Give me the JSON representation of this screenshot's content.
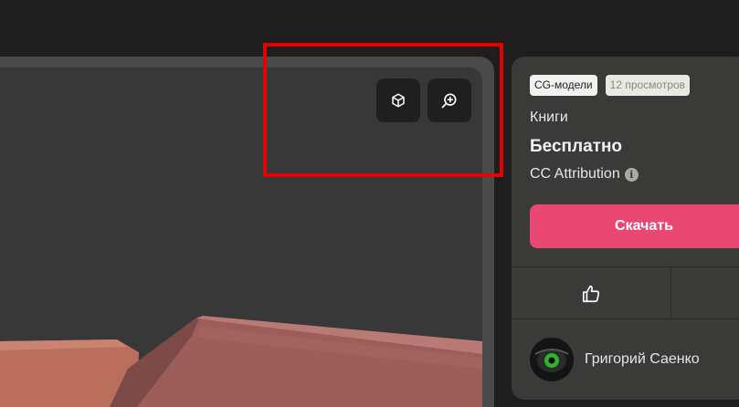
{
  "viewer": {
    "btn_3d_icon": "cube-icon",
    "btn_zoom_icon": "zoom-in-icon"
  },
  "sidebar": {
    "tags": {
      "category_tag": "CG-модели",
      "views_tag": "12 просмотров"
    },
    "category": "Книги",
    "price": "Бесплатно",
    "license": "CC Attribution",
    "download_label": "Скачать",
    "like_icon": "thumbs-up-icon",
    "author_name": "Григорий Саенко"
  },
  "colors": {
    "accent": "#e84872",
    "highlight": "#e60000"
  }
}
